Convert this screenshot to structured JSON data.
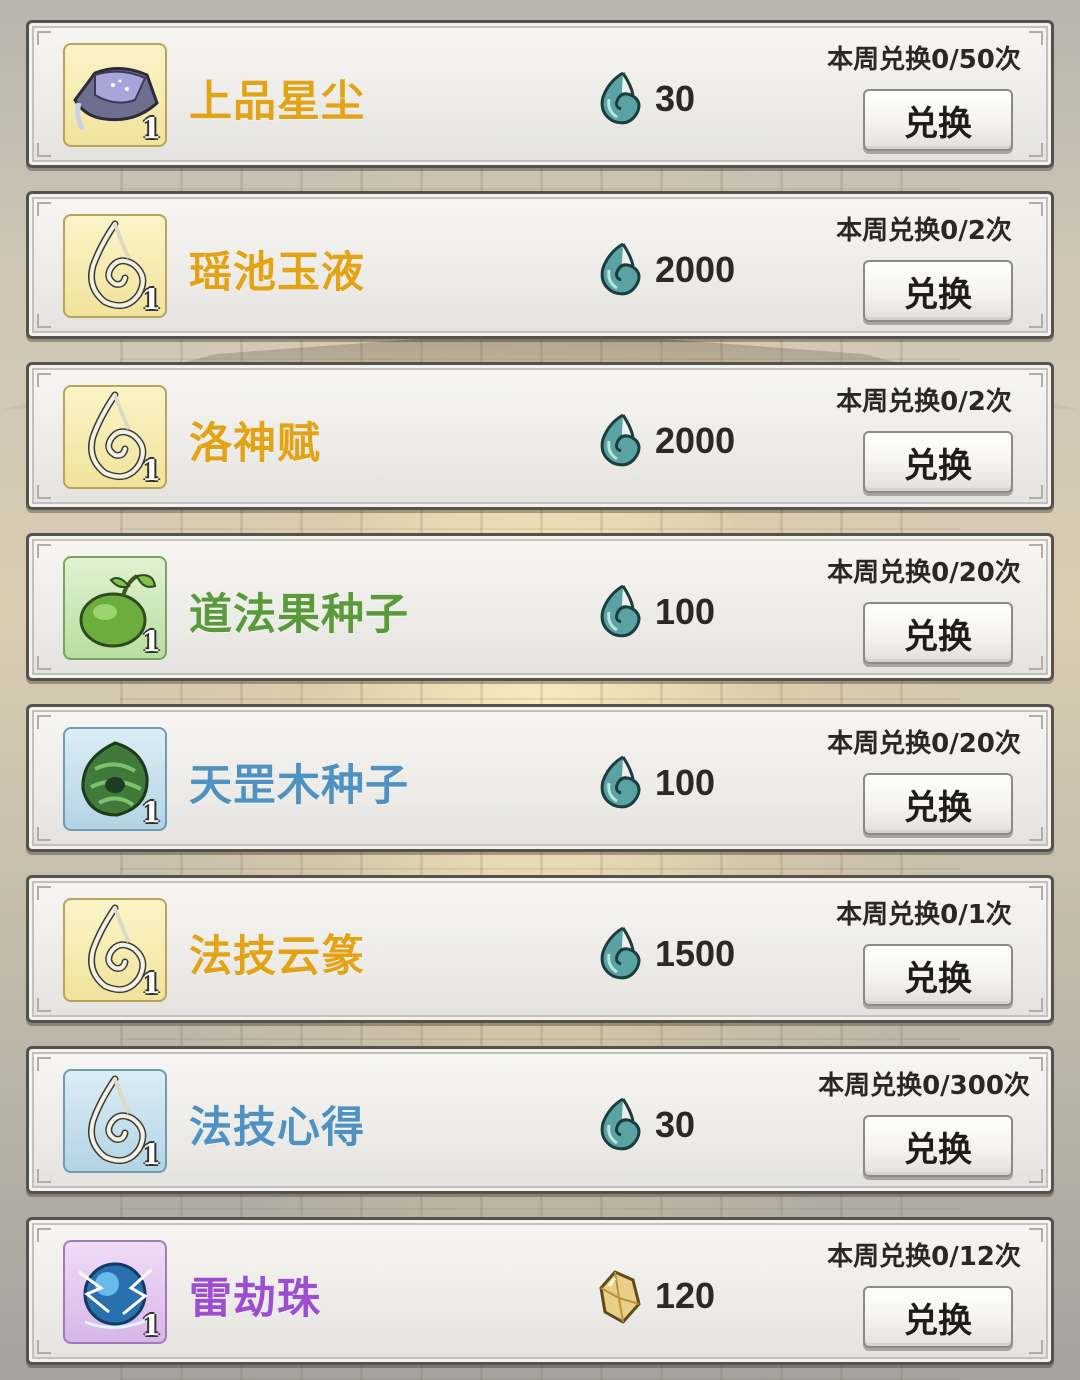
{
  "colors": {
    "gold": "#e3a317",
    "green": "#5a9a3a",
    "blue": "#4f92c2",
    "purple": "#9b4fd0"
  },
  "items": [
    {
      "name": "上品星尘",
      "color": "gold",
      "icon": "stardust-icon",
      "icon_bg": "bg-yellow",
      "qty": "1",
      "currency": "spirit-swirl-icon",
      "price": "30",
      "limit": "本周兑换0/50次",
      "button": "兑换"
    },
    {
      "name": "瑶池玉液",
      "color": "gold",
      "icon": "jade-comma-icon",
      "icon_bg": "bg-yellow",
      "qty": "1",
      "currency": "spirit-swirl-icon",
      "price": "2000",
      "limit": "本周兑换0/2次",
      "button": "兑换"
    },
    {
      "name": "洛神赋",
      "color": "gold",
      "icon": "jade-comma-icon",
      "icon_bg": "bg-yellow",
      "qty": "1",
      "currency": "spirit-swirl-icon",
      "price": "2000",
      "limit": "本周兑换0/2次",
      "button": "兑换"
    },
    {
      "name": "道法果种子",
      "color": "green",
      "icon": "green-seed-icon",
      "icon_bg": "bg-green",
      "qty": "1",
      "currency": "spirit-swirl-icon",
      "price": "100",
      "limit": "本周兑换0/20次",
      "button": "兑换"
    },
    {
      "name": "天罡木种子",
      "color": "blue",
      "icon": "wood-seed-icon",
      "icon_bg": "bg-blue",
      "qty": "1",
      "currency": "spirit-swirl-icon",
      "price": "100",
      "limit": "本周兑换0/20次",
      "button": "兑换"
    },
    {
      "name": "法技云篆",
      "color": "gold",
      "icon": "jade-comma-icon",
      "icon_bg": "bg-yellow",
      "qty": "1",
      "currency": "spirit-swirl-icon",
      "price": "1500",
      "limit": "本周兑换0/1次",
      "button": "兑换"
    },
    {
      "name": "法技心得",
      "color": "blue",
      "icon": "jade-comma-icon",
      "icon_bg": "bg-blue",
      "qty": "1",
      "currency": "spirit-swirl-icon",
      "price": "30",
      "limit": "本周兑换0/300次",
      "button": "兑换"
    },
    {
      "name": "雷劫珠",
      "color": "purple",
      "icon": "thunder-orb-icon",
      "icon_bg": "bg-purple",
      "qty": "1",
      "currency": "crystal-icon",
      "price": "120",
      "limit": "本周兑换0/12次",
      "button": "兑换"
    }
  ]
}
